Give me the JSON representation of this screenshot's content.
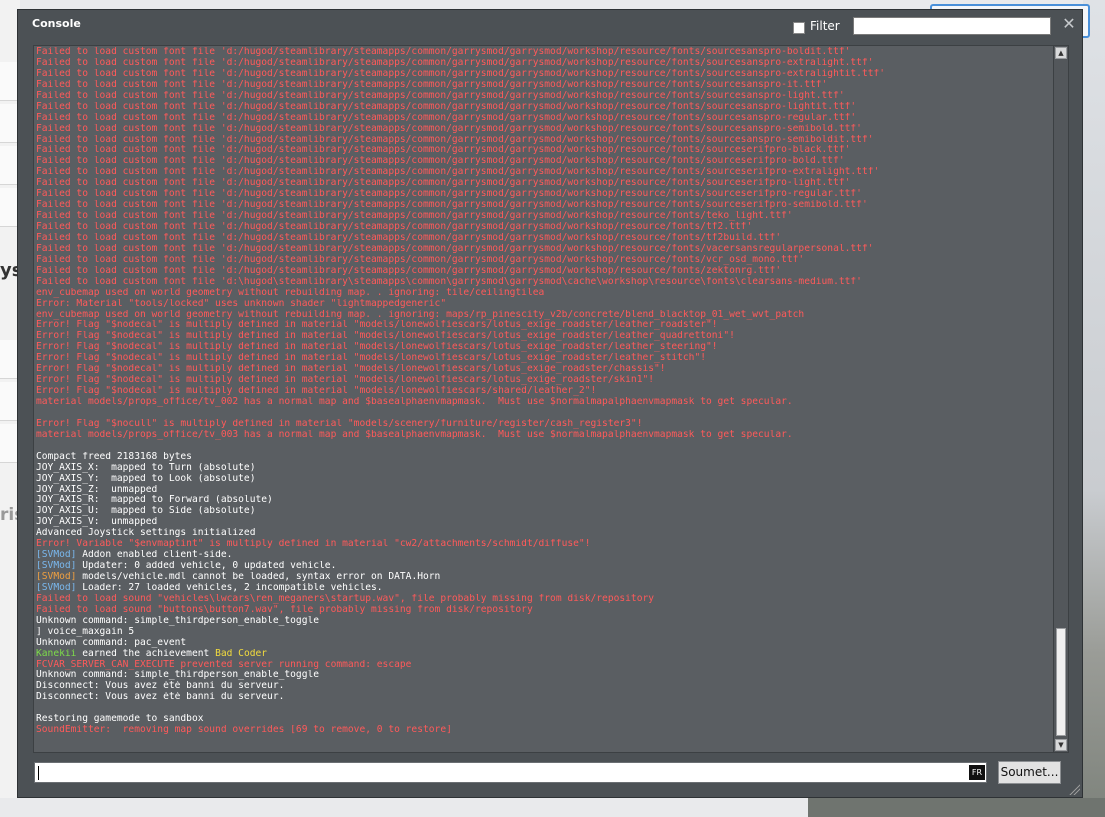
{
  "background": {
    "left_text_1": "ys",
    "left_text_2": "ris"
  },
  "console": {
    "title": "Console",
    "filter_label": "Filter",
    "filter_value": "",
    "close_glyph": "✕",
    "input_value": "",
    "lang_badge": "FR",
    "submit_label": "Soumet..."
  },
  "colors": {
    "error": "#ff5a5a",
    "normal": "#ffffff",
    "svmod": "#7ab8ee",
    "svmod_warn": "#f0a040",
    "player": "#7ddc4a",
    "achievement": "#f3dc3d",
    "window_bg": "#4c5155",
    "log_bg": "#5a5e62"
  },
  "log_lines": [
    [
      {
        "t": "Failed to load custom font file 'd:/hugod/steamlibrary/steamapps/common/garrysmod/garrysmod/workshop/resource/fonts/sourcesanspro-boldit.ttf'",
        "c": "red"
      }
    ],
    [
      {
        "t": "Failed to load custom font file 'd:/hugod/steamlibrary/steamapps/common/garrysmod/garrysmod/workshop/resource/fonts/sourcesanspro-extralight.ttf'",
        "c": "red"
      }
    ],
    [
      {
        "t": "Failed to load custom font file 'd:/hugod/steamlibrary/steamapps/common/garrysmod/garrysmod/workshop/resource/fonts/sourcesanspro-extralightit.ttf'",
        "c": "red"
      }
    ],
    [
      {
        "t": "Failed to load custom font file 'd:/hugod/steamlibrary/steamapps/common/garrysmod/garrysmod/workshop/resource/fonts/sourcesanspro-it.ttf'",
        "c": "red"
      }
    ],
    [
      {
        "t": "Failed to load custom font file 'd:/hugod/steamlibrary/steamapps/common/garrysmod/garrysmod/workshop/resource/fonts/sourcesanspro-light.ttf'",
        "c": "red"
      }
    ],
    [
      {
        "t": "Failed to load custom font file 'd:/hugod/steamlibrary/steamapps/common/garrysmod/garrysmod/workshop/resource/fonts/sourcesanspro-lightit.ttf'",
        "c": "red"
      }
    ],
    [
      {
        "t": "Failed to load custom font file 'd:/hugod/steamlibrary/steamapps/common/garrysmod/garrysmod/workshop/resource/fonts/sourcesanspro-regular.ttf'",
        "c": "red"
      }
    ],
    [
      {
        "t": "Failed to load custom font file 'd:/hugod/steamlibrary/steamapps/common/garrysmod/garrysmod/workshop/resource/fonts/sourcesanspro-semibold.ttf'",
        "c": "red"
      }
    ],
    [
      {
        "t": "Failed to load custom font file 'd:/hugod/steamlibrary/steamapps/common/garrysmod/garrysmod/workshop/resource/fonts/sourcesanspro-semiboldit.ttf'",
        "c": "red"
      }
    ],
    [
      {
        "t": "Failed to load custom font file 'd:/hugod/steamlibrary/steamapps/common/garrysmod/garrysmod/workshop/resource/fonts/sourceserifpro-black.ttf'",
        "c": "red"
      }
    ],
    [
      {
        "t": "Failed to load custom font file 'd:/hugod/steamlibrary/steamapps/common/garrysmod/garrysmod/workshop/resource/fonts/sourceserifpro-bold.ttf'",
        "c": "red"
      }
    ],
    [
      {
        "t": "Failed to load custom font file 'd:/hugod/steamlibrary/steamapps/common/garrysmod/garrysmod/workshop/resource/fonts/sourceserifpro-extralight.ttf'",
        "c": "red"
      }
    ],
    [
      {
        "t": "Failed to load custom font file 'd:/hugod/steamlibrary/steamapps/common/garrysmod/garrysmod/workshop/resource/fonts/sourceserifpro-light.ttf'",
        "c": "red"
      }
    ],
    [
      {
        "t": "Failed to load custom font file 'd:/hugod/steamlibrary/steamapps/common/garrysmod/garrysmod/workshop/resource/fonts/sourceserifpro-regular.ttf'",
        "c": "red"
      }
    ],
    [
      {
        "t": "Failed to load custom font file 'd:/hugod/steamlibrary/steamapps/common/garrysmod/garrysmod/workshop/resource/fonts/sourceserifpro-semibold.ttf'",
        "c": "red"
      }
    ],
    [
      {
        "t": "Failed to load custom font file 'd:/hugod/steamlibrary/steamapps/common/garrysmod/garrysmod/workshop/resource/fonts/teko_light.ttf'",
        "c": "red"
      }
    ],
    [
      {
        "t": "Failed to load custom font file 'd:/hugod/steamlibrary/steamapps/common/garrysmod/garrysmod/workshop/resource/fonts/tf2.ttf'",
        "c": "red"
      }
    ],
    [
      {
        "t": "Failed to load custom font file 'd:/hugod/steamlibrary/steamapps/common/garrysmod/garrysmod/workshop/resource/fonts/tf2build.ttf'",
        "c": "red"
      }
    ],
    [
      {
        "t": "Failed to load custom font file 'd:/hugod/steamlibrary/steamapps/common/garrysmod/garrysmod/workshop/resource/fonts/vacersansregularpersonal.ttf'",
        "c": "red"
      }
    ],
    [
      {
        "t": "Failed to load custom font file 'd:/hugod/steamlibrary/steamapps/common/garrysmod/garrysmod/workshop/resource/fonts/vcr_osd_mono.ttf'",
        "c": "red"
      }
    ],
    [
      {
        "t": "Failed to load custom font file 'd:/hugod/steamlibrary/steamapps/common/garrysmod/garrysmod/workshop/resource/fonts/zektonrg.ttf'",
        "c": "red"
      }
    ],
    [
      {
        "t": "Failed to load custom font file 'd:\\hugod\\steamlibrary\\steamapps\\common\\garrysmod\\garrysmod\\cache\\workshop\\resource\\fonts\\clearsans-medium.ttf'",
        "c": "red"
      }
    ],
    [
      {
        "t": "env_cubemap used on world geometry without rebuilding map. . ignoring: tile/ceilingtilea",
        "c": "red"
      }
    ],
    [
      {
        "t": "Error: Material \"tools/locked\" uses unknown shader \"lightmappedgeneric\"",
        "c": "red"
      }
    ],
    [
      {
        "t": "env_cubemap used on world geometry without rebuilding map. . ignoring: maps/rp_pinescity_v2b/concrete/blend_blacktop_01_wet_wvt_patch",
        "c": "red"
      }
    ],
    [
      {
        "t": "Error! Flag \"$nodecal\" is multiply defined in material \"models/lonewolfiescars/lotus_exige_roadster/leather_roadster\"!",
        "c": "red"
      }
    ],
    [
      {
        "t": "Error! Flag \"$nodecal\" is multiply defined in material \"models/lonewolfiescars/lotus_exige_roadster/leather_quadrettoni\"!",
        "c": "red"
      }
    ],
    [
      {
        "t": "Error! Flag \"$nodecal\" is multiply defined in material \"models/lonewolfiescars/lotus_exige_roadster/leather_steering\"!",
        "c": "red"
      }
    ],
    [
      {
        "t": "Error! Flag \"$nodecal\" is multiply defined in material \"models/lonewolfiescars/lotus_exige_roadster/leather_stitch\"!",
        "c": "red"
      }
    ],
    [
      {
        "t": "Error! Flag \"$nodecal\" is multiply defined in material \"models/lonewolfiescars/lotus_exige_roadster/chassis\"!",
        "c": "red"
      }
    ],
    [
      {
        "t": "Error! Flag \"$nodecal\" is multiply defined in material \"models/lonewolfiescars/lotus_exige_roadster/skin1\"!",
        "c": "red"
      }
    ],
    [
      {
        "t": "Error! Flag \"$nodecal\" is multiply defined in material \"models/lonewolfiescars/shared/leather_2\"!",
        "c": "red"
      }
    ],
    [
      {
        "t": "material models/props_office/tv_002 has a normal map and $basealphaenvmapmask.  Must use $normalmapalphaenvmapmask to get specular.",
        "c": "red"
      }
    ],
    [
      {
        "t": "",
        "c": "white"
      }
    ],
    [
      {
        "t": "Error! Flag \"$nocull\" is multiply defined in material \"models/scenery/furniture/register/cash_register3\"!",
        "c": "red"
      }
    ],
    [
      {
        "t": "material models/props_office/tv_003 has a normal map and $basealphaenvmapmask.  Must use $normalmapalphaenvmapmask to get specular.",
        "c": "red"
      }
    ],
    [
      {
        "t": "",
        "c": "white"
      }
    ],
    [
      {
        "t": "Compact freed 2183168 bytes",
        "c": "white"
      }
    ],
    [
      {
        "t": "JOY_AXIS_X:  mapped to Turn (absolute)",
        "c": "white"
      }
    ],
    [
      {
        "t": "JOY_AXIS_Y:  mapped to Look (absolute)",
        "c": "white"
      }
    ],
    [
      {
        "t": "JOY_AXIS_Z:  unmapped",
        "c": "white"
      }
    ],
    [
      {
        "t": "JOY_AXIS_R:  mapped to Forward (absolute)",
        "c": "white"
      }
    ],
    [
      {
        "t": "JOY_AXIS_U:  mapped to Side (absolute)",
        "c": "white"
      }
    ],
    [
      {
        "t": "JOY_AXIS_V:  unmapped",
        "c": "white"
      }
    ],
    [
      {
        "t": "Advanced Joystick settings initialized",
        "c": "white"
      }
    ],
    [
      {
        "t": "Error! Variable \"$envmaptint\" is multiply defined in material \"cw2/attachments/schmidt/diffuse\"!",
        "c": "red"
      }
    ],
    [
      {
        "t": "[SVMod] ",
        "c": "blue"
      },
      {
        "t": "Addon enabled client-side.",
        "c": "white"
      }
    ],
    [
      {
        "t": "[SVMod] ",
        "c": "blue"
      },
      {
        "t": "Updater: 0 added vehicle, 0 updated vehicle.",
        "c": "white"
      }
    ],
    [
      {
        "t": "[SVMod] ",
        "c": "orange"
      },
      {
        "t": "models/vehicle.mdl cannot be loaded, syntax error on DATA.Horn",
        "c": "white"
      }
    ],
    [
      {
        "t": "[SVMod] ",
        "c": "blue"
      },
      {
        "t": "Loader: 27 loaded vehicles, 2 incompatible vehicles.",
        "c": "white"
      }
    ],
    [
      {
        "t": "Failed to load sound \"vehicles\\lwcars\\ren_meganers\\startup.wav\", file probably missing from disk/repository",
        "c": "red"
      }
    ],
    [
      {
        "t": "Failed to load sound \"buttons\\button7.wav\", file probably missing from disk/repository",
        "c": "red"
      }
    ],
    [
      {
        "t": "Unknown command: simple_thirdperson_enable_toggle",
        "c": "white"
      }
    ],
    [
      {
        "t": "] voice_maxgain 5",
        "c": "white"
      }
    ],
    [
      {
        "t": "Unknown command: pac_event",
        "c": "white"
      }
    ],
    [
      {
        "t": "Kanekii",
        "c": "green"
      },
      {
        "t": " earned the achievement ",
        "c": "white"
      },
      {
        "t": "Bad Coder",
        "c": "yellow"
      }
    ],
    [
      {
        "t": "FCVAR_SERVER_CAN_EXECUTE prevented server running command: escape",
        "c": "red"
      }
    ],
    [
      {
        "t": "Unknown command: simple_thirdperson_enable_toggle",
        "c": "white"
      }
    ],
    [
      {
        "t": "Disconnect: Vous avez été banni du serveur.",
        "c": "white"
      }
    ],
    [
      {
        "t": "Disconnect: Vous avez été banni du serveur.",
        "c": "white"
      }
    ],
    [
      {
        "t": "",
        "c": "white"
      }
    ],
    [
      {
        "t": "Restoring gamemode to sandbox",
        "c": "white"
      }
    ],
    [
      {
        "t": "SoundEmitter:  removing map sound overrides [69 to remove, 0 to restore]",
        "c": "red"
      }
    ]
  ]
}
